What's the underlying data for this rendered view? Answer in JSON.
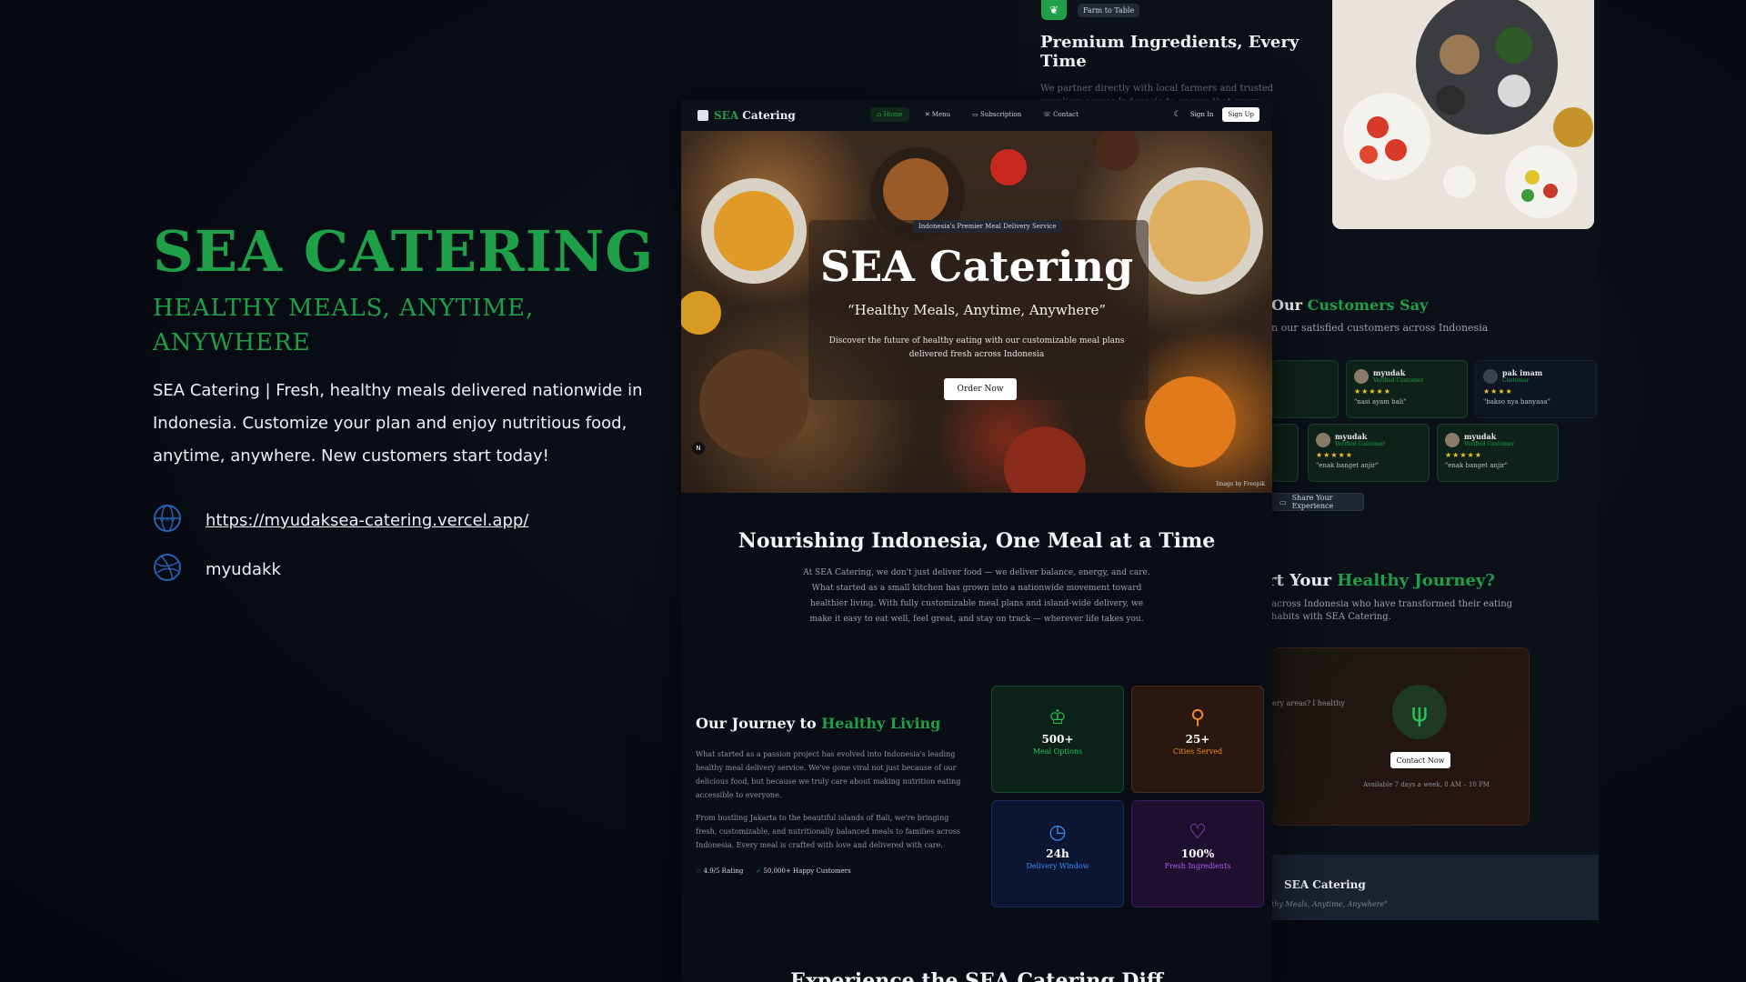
{
  "brand": {
    "title": "SEA CATERING",
    "subtitle": "HEALTHY MEALS, ANYTIME, ANYWHERE",
    "description": "SEA Catering | Fresh, healthy meals delivered nationwide in Indonesia. Customize your plan and enjoy nutritious food, anytime, anywhere. New customers start today!",
    "url": "https://myudaksea-catering.vercel.app/",
    "dribbble": "myudakk",
    "accent_color": "#1f9f48"
  },
  "back_top": {
    "badge": "Farm to Table",
    "title": "Premium Ingredients, Every Time",
    "text": "We partner directly with local farmers and trusted suppliers across Indonesia to ensure that every ingredient is fresh. Every"
  },
  "testimonials": {
    "title_prefix": "Our ",
    "title_highlight": "Customers Say",
    "subtitle": "n our satisfied customers across Indonesia",
    "cards": [
      {
        "name": "myudak",
        "badge": "Verified Customer",
        "quote": "\"nasi ayam bali\""
      },
      {
        "name": "pak imam",
        "badge": "Customer",
        "quote": "\"bakso nya banyaaa\""
      },
      {
        "name": "myudak",
        "badge": "Verified Customer",
        "quote": "\"enak banget anjir\""
      },
      {
        "name": "myudak",
        "badge": "Verified Customer",
        "quote": "\"enak banget anjir\""
      }
    ],
    "share_label": "Share Your Experience"
  },
  "journey_cta": {
    "title_prefix": "rt Your ",
    "title_highlight": "Healthy Journey?",
    "subtitle": "across Indonesia who have transformed their eating habits with SEA Catering.",
    "question": "ery areas? l healthy",
    "button": "Contact Now",
    "availability": "Available 7 days a week, 8 AM – 10 PM"
  },
  "footer": {
    "name": "SEA Catering",
    "tagline": "thy Meals, Anytime, Anywhere\""
  },
  "nav": {
    "logo_prefix": "SEA",
    "logo_suffix": " Catering",
    "links": [
      "Home",
      "Menu",
      "Subscription",
      "Contact"
    ],
    "signin": "Sign In",
    "signup": "Sign Up"
  },
  "hero": {
    "pill": "Indonesia's Premier Meal Delivery Service",
    "title": "SEA Catering",
    "tagline": "“Healthy Meals, Anytime, Anywhere”",
    "description": "Discover the future of healthy eating with our customizable meal plans delivered fresh across Indonesia",
    "button": "Order Now",
    "credit": "Image by Freepik"
  },
  "about": {
    "title": "Nourishing Indonesia, One Meal at a Time",
    "text": "At SEA Catering, we don't just deliver food — we deliver balance, energy, and care. What started as a small kitchen has grown into a nationwide movement toward healthier living. With fully customizable meal plans and island-wide delivery, we make it easy to eat well, feel great, and stay on track — wherever life takes you."
  },
  "journey": {
    "title_prefix": "Our Journey to ",
    "title_highlight": "Healthy Living",
    "p1": "What started as a passion project has evolved into Indonesia's leading healthy meal delivery service. We've gone viral not just because of our delicious food, but because we truly care about making nutrition eating accessible to everyone.",
    "p2": "From bustling Jakarta to the beautiful islands of Bali, we're bringing fresh, customizable, and nutritionally balanced meals to families across Indonesia. Every meal is crafted with love and delivered with care.",
    "rating": "4.9/5 Rating",
    "customers": "50,000+ Happy Customers"
  },
  "stats": [
    {
      "value": "500+",
      "label": "Meal Options",
      "color": "#27c35a"
    },
    {
      "value": "25+",
      "label": "Cities Served",
      "color": "#f08a2a"
    },
    {
      "value": "24h",
      "label": "Delivery Window",
      "color": "#3b8ef0"
    },
    {
      "value": "100%",
      "label": "Fresh Ingredients",
      "color": "#b05cf0"
    }
  ],
  "bottom": {
    "title": "Experience the SEA Catering Diff"
  }
}
